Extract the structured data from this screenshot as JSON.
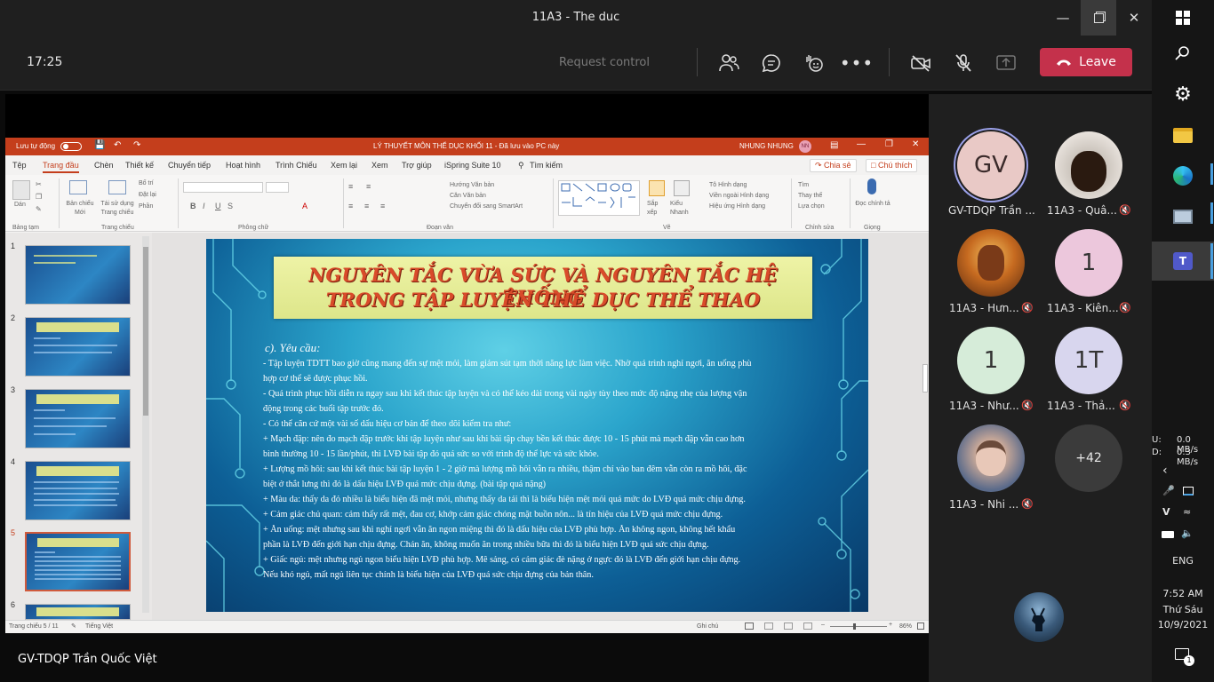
{
  "window": {
    "title": "11A3 - The duc"
  },
  "call": {
    "timer": "17:25",
    "request_control": "Request control",
    "leave_label": "Leave",
    "colors": {
      "leave": "#c4314b"
    }
  },
  "ppt": {
    "autosave": "Lưu tự động",
    "title": "LÝ THUYẾT MÔN THỂ DỤC KHỐI 11 - Đã lưu vào PC này",
    "user": "NHUNG NHUNG",
    "user_initials": "NN",
    "tabs": [
      "Tệp",
      "Trang đầu",
      "Chèn",
      "Thiết kế",
      "Chuyển tiếp",
      "Hoạt hình",
      "Trình Chiếu",
      "Xem lại",
      "Xem",
      "Trợ giúp",
      "iSpring Suite 10",
      "Tìm kiếm"
    ],
    "share": "Chia sẻ",
    "comments": "Chú thích",
    "ribbon": {
      "paste": "Dán",
      "new_slide": "Bản chiếu Mới",
      "reuse": "Tái sử dụng Trang chiếu",
      "layout": "Bố trí",
      "reset": "Đặt lại",
      "section": "Phần",
      "text_dir": "Hướng Văn bản",
      "align_text": "Căn Văn bản",
      "smartart": "Chuyển đổi sang SmartArt",
      "arrange": "Sắp xếp",
      "styles": "Kiểu Nhanh",
      "fill": "Tô Hình dạng",
      "outline": "Viền ngoài Hình dạng",
      "effects": "Hiệu ứng Hình dạng",
      "find": "Tìm",
      "replace": "Thay thế",
      "select": "Lựa chọn",
      "dictate": "Đọc chính tả",
      "groups": [
        "Bảng tạm",
        "Trang chiếu",
        "Phông chữ",
        "Đoạn văn",
        "Vẽ",
        "Chỉnh sửa",
        "Giọng"
      ]
    },
    "slide_numbers": [
      "1",
      "2",
      "3",
      "4",
      "5",
      "6"
    ],
    "slide": {
      "title_line1": "NGUYÊN TẮC VỪA SỨC VÀ NGUYÊN TẮC HỆ THỐNG",
      "title_line2": "TRONG TẬP LUYỆN THỂ DỤC THỂ THAO",
      "subtitle": "c). Yêu cầu:",
      "lines": [
        " - Tập luyện TDTT bao giờ cũng mang đến sự mệt mỏi, làm giảm sút tạm thời năng lực làm việc. Nhờ quá trình nghỉ ngơi, ăn uống phù",
        "hợp cơ thể sẽ được phục hồi.",
        " - Quá trình phục hồi diễn ra ngay sau khi kết thúc tập luyện và có thể kéo dài trong vài ngày tùy theo mức độ nặng nhẹ của lượng vận",
        "động trong các buổi tập trước đó.",
        " - Có thể căn cứ một vài số dấu hiệu cơ bản để theo dõi kiểm tra như:",
        "  + Mạch đập: nên đo mạch đập trước khi tập luyện như sau khi bài tập chạy bền kết thúc được 10 - 15 phút mà mạch đập vẫn cao hơn",
        "bình thường 10 - 15 lần/phút, thì LVĐ bài tập đó quá sức so với trình độ thể lực và sức khỏe.",
        "  + Lượng mồ hôi: sau khi kết thúc bài tập luyện 1 - 2 giờ mà lượng mồ hôi vẫn ra nhiều, thậm chí vào ban đêm vẫn còn ra mồ hôi, đặc",
        "biệt ở thắt lưng thì đó là dấu hiệu LVĐ quá mức chịu đựng. (bài tập quá nặng)",
        "  + Màu da: thấy da đỏ nhiều là biểu hiện đã mệt mỏi, nhưng thấy da tái thì là biểu hiện mệt mỏi quá mức do LVĐ quá mức chịu đựng.",
        "  + Cảm giác chủ quan: cảm thấy rất mệt, đau cơ, khớp cảm giác chóng mặt buồn nôn... là tín hiệu của LVĐ quá mức chịu đựng.",
        "  + Ăn uống: mệt nhưng sau khi nghỉ ngơi vẫn ăn ngon miệng thì đó là dấu hiệu của LVĐ phù hợp. Ăn không ngon, không hết khẩu",
        "phần là LVĐ đến giới hạn chịu đựng. Chán ăn, không muốn ăn trong nhiều bữa thì đó là biểu hiện LVĐ quá sức chịu đựng.",
        "  + Giấc ngủ: mệt nhưng ngủ ngon biểu hiện LVĐ phù hợp. Mê sảng, có cảm giác đè nặng ở ngực đó là LVĐ đến giới hạn chịu đựng.",
        "Nếu khó ngủ, mất ngủ liên tục chính là biểu hiện của LVĐ quá sức chịu đựng của bản thân."
      ]
    },
    "status": {
      "slide_count": "Trang chiếu 5 / 11",
      "language": "Tiếng Việt",
      "notes": "Ghi chú",
      "zoom": "86%"
    },
    "colors": {
      "title_bar": "#c43e1c"
    }
  },
  "presenter": "GV-TDQP Trần Quốc Việt",
  "participants": [
    {
      "name": "GV-TDQP Trần ...",
      "initials": "GV",
      "bg": "#e9c9c6",
      "fg": "#3a2a2a",
      "muted": false,
      "ring": true
    },
    {
      "name": "11A3 - Quâ...",
      "initials": "",
      "bg": "#4a3020",
      "fg": "#fff",
      "muted": true,
      "ring": false
    },
    {
      "name": "11A3 - Hưn...",
      "initials": "",
      "bg": "#a85a20",
      "fg": "#fff",
      "muted": true,
      "ring": false
    },
    {
      "name": "11A3 - Kiên...",
      "initials": "1",
      "bg": "#ecc7dc",
      "fg": "#333",
      "muted": true,
      "ring": false
    },
    {
      "name": "11A3 - Như...",
      "initials": "1",
      "bg": "#d6ecd9",
      "fg": "#333",
      "muted": true,
      "ring": false
    },
    {
      "name": "11A3 - Thả...",
      "initials": "1T",
      "bg": "#d8d6ee",
      "fg": "#333",
      "muted": true,
      "ring": false
    },
    {
      "name": "11A3 - Nhi ...",
      "initials": "",
      "bg": "#6a7a9a",
      "fg": "#fff",
      "muted": true,
      "ring": false
    }
  ],
  "more_participants": "+42",
  "taskbar": {
    "net_up_label": "U:",
    "net_up": "0.0 MB/s",
    "net_down_label": "D:",
    "net_down": "0.3 MB/s",
    "lang": "ENG",
    "time": "7:52 AM",
    "day": "Thứ Sáu",
    "date": "10/9/2021",
    "notif_count": "1"
  }
}
